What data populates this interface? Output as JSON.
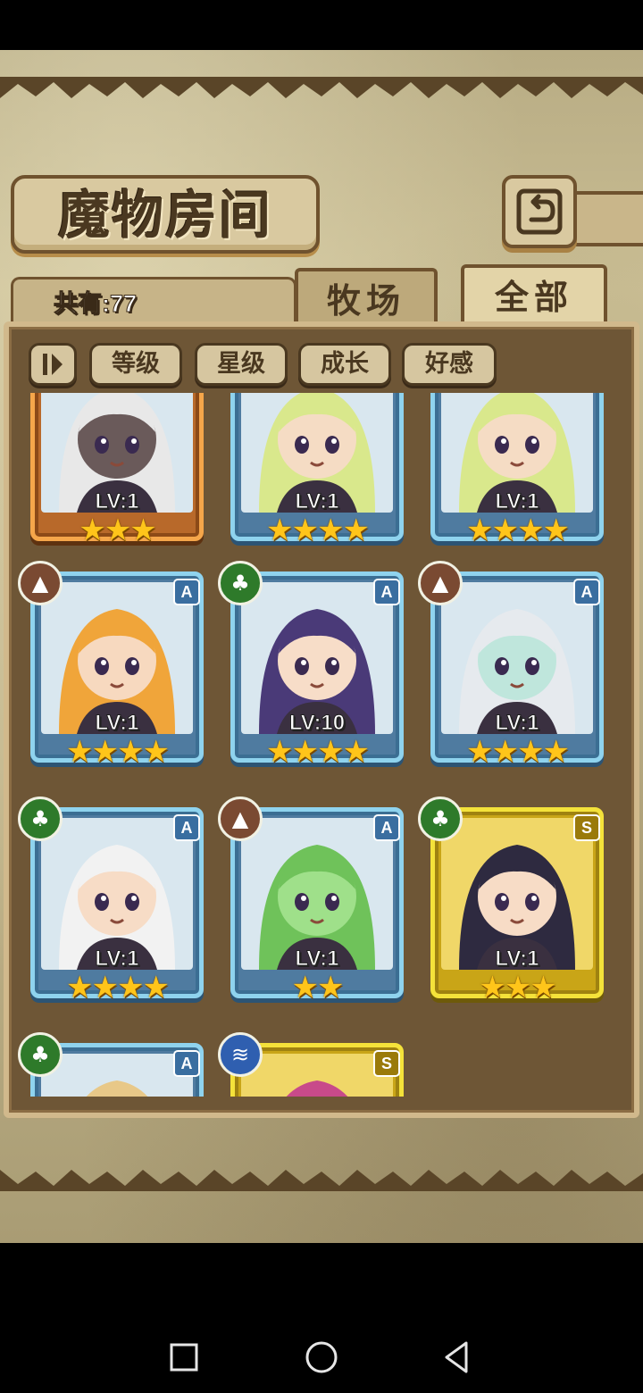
{
  "header": {
    "title": "魔物房间"
  },
  "summary": {
    "count_label": "共有:77"
  },
  "tabs": [
    {
      "label": "牧场",
      "selected": false
    },
    {
      "label": "全部",
      "selected": true
    }
  ],
  "filters": [
    "等级",
    "星级",
    "成长",
    "好感"
  ],
  "monsters": [
    {
      "level": "LV:1",
      "stars": "★★★",
      "star_count": 3,
      "frame": "orange",
      "rank": "",
      "element": "",
      "hair": "#e8e8e8",
      "skin": "#6a5a5a"
    },
    {
      "level": "LV:1",
      "stars": "★★★★",
      "star_count": 4,
      "frame": "blue",
      "rank": "",
      "element": "",
      "hair": "#d9e88c",
      "skin": "#f5dcc4"
    },
    {
      "level": "LV:1",
      "stars": "★★★★",
      "star_count": 4,
      "frame": "blue",
      "rank": "",
      "element": "",
      "hair": "#d9e88c",
      "skin": "#f5dcc4"
    },
    {
      "level": "LV:1",
      "stars": "★★★★",
      "star_count": 4,
      "frame": "blue",
      "rank": "A",
      "element": "earth",
      "hair": "#f0a53a",
      "skin": "#f7d9bf"
    },
    {
      "level": "LV:10",
      "stars": "★★★★",
      "star_count": 4,
      "frame": "blue",
      "rank": "A",
      "element": "wood",
      "hair": "#4a3a78",
      "skin": "#f7ddc8"
    },
    {
      "level": "LV:1",
      "stars": "★★★★",
      "star_count": 4,
      "frame": "blue",
      "rank": "A",
      "element": "earth",
      "hair": "#e6eaee",
      "skin": "#bfe6dc"
    },
    {
      "level": "LV:1",
      "stars": "★★★★",
      "star_count": 4,
      "frame": "blue",
      "rank": "A",
      "element": "wood",
      "hair": "#f2f2f2",
      "skin": "#f7dcc6"
    },
    {
      "level": "LV:1",
      "stars": "★★",
      "star_count": 2,
      "frame": "blue",
      "rank": "A",
      "element": "earth",
      "hair": "#6fc25a",
      "skin": "#9fe08a"
    },
    {
      "level": "LV:1",
      "stars": "★★★",
      "star_count": 3,
      "frame": "gold",
      "rank": "S",
      "element": "wood",
      "hair": "#2e2a40",
      "skin": "#f7dcc6"
    },
    {
      "level": "",
      "stars": "",
      "star_count": 0,
      "frame": "blue",
      "rank": "A",
      "element": "wood",
      "hair": "#e8c888",
      "skin": "#f7dcc6"
    },
    {
      "level": "",
      "stars": "",
      "star_count": 0,
      "frame": "gold",
      "rank": "S",
      "element": "water",
      "hair": "#c84a8a",
      "skin": "#f7dcc6"
    }
  ]
}
